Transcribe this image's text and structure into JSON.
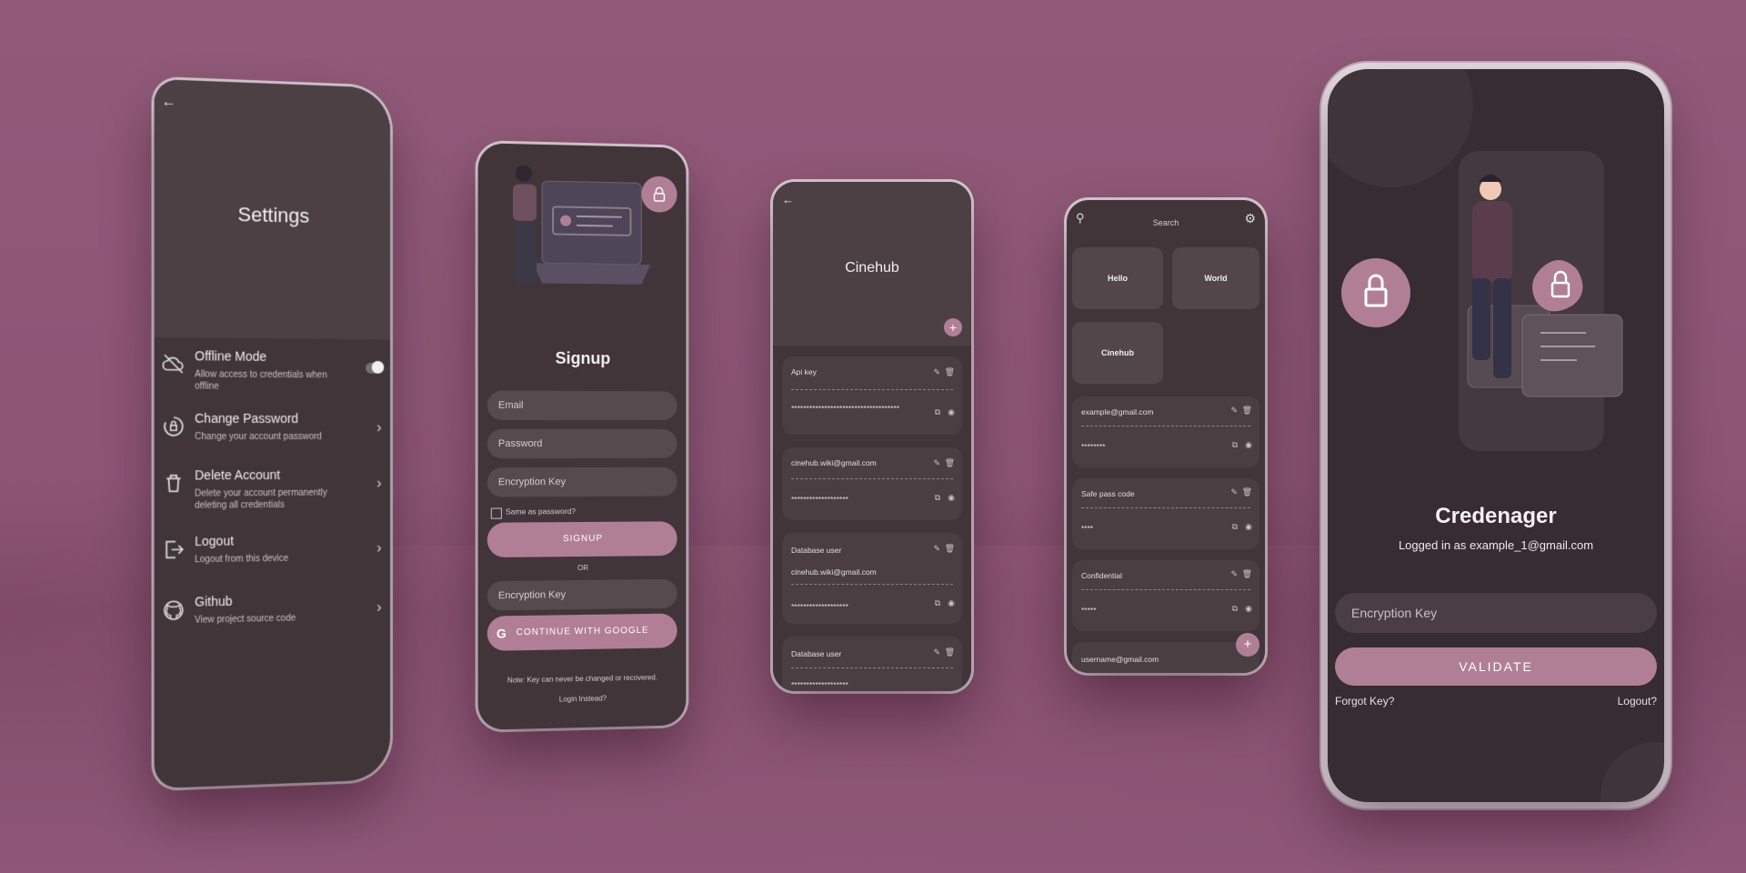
{
  "settings": {
    "title": "Settings",
    "back_icon": "arrow-left-icon",
    "items": [
      {
        "icon": "cloud-off-icon",
        "title": "Offline Mode",
        "subtitle": "Allow access to credentials when offline",
        "control": "toggle"
      },
      {
        "icon": "lock-reset-icon",
        "title": "Change Password",
        "subtitle": "Change your account password",
        "control": "chevron"
      },
      {
        "icon": "trash-icon",
        "title": "Delete Account",
        "subtitle": "Delete your account permanently deleting all credentials",
        "control": "chevron"
      },
      {
        "icon": "logout-icon",
        "title": "Logout",
        "subtitle": "Logout from this device",
        "control": "chevron"
      },
      {
        "icon": "github-icon",
        "title": "Github",
        "subtitle": "View project source code",
        "control": "chevron"
      }
    ]
  },
  "signup": {
    "title": "Signup",
    "email_placeholder": "Email",
    "password_placeholder": "Password",
    "encryption_placeholder": "Encryption Key",
    "same_as_password": "Same as password?",
    "signup_button": "SIGNUP",
    "or": "OR",
    "encryption_placeholder_2": "Encryption Key",
    "google_button": "CONTINUE WITH GOOGLE",
    "note": "Note: Key can never be changed or recovered.",
    "login_link": "Login Instead?"
  },
  "cinehub": {
    "title": "Cinehub",
    "cards": [
      {
        "label": "Api key",
        "value": "************************************"
      },
      {
        "label": "cinehub.wiki@gmail.com",
        "value": "*******************"
      },
      {
        "label": "Database user",
        "label2": "cinehub.wiki@gmail.com",
        "value": "*******************"
      },
      {
        "label": "Database user",
        "value": "*******************"
      }
    ]
  },
  "vault": {
    "search_placeholder": "Search",
    "tiles": [
      "Hello",
      "World",
      "Cinehub"
    ],
    "entries": [
      {
        "label": "example@gmail.com",
        "value": "********"
      },
      {
        "label": "Safe pass code",
        "value": "****"
      },
      {
        "label": "Confidential",
        "value": "*****"
      },
      {
        "label": "username@gmail.com",
        "value": ""
      }
    ]
  },
  "login": {
    "app_name": "Credenager",
    "logged_in_as": "Logged in as example_1@gmail.com",
    "encryption_placeholder": "Encryption Key",
    "validate_button": "VALIDATE",
    "forgot_key": "Forgot Key?",
    "logout": "Logout?"
  },
  "colors": {
    "accent": "#b07f96",
    "background": "#8c5574",
    "surface": "#413539"
  }
}
